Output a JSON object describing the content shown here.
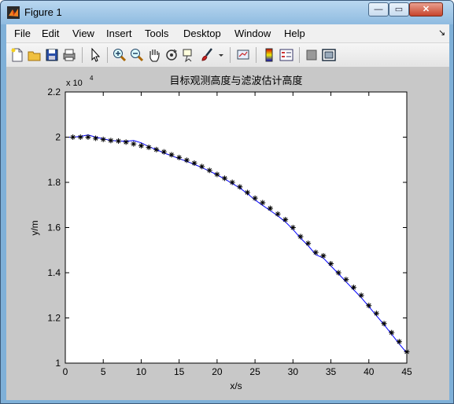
{
  "window": {
    "title": "Figure 1",
    "minimize": "—",
    "maximize": "▭",
    "close": "✕"
  },
  "menu": [
    "File",
    "Edit",
    "View",
    "Insert",
    "Tools",
    "Desktop",
    "Window",
    "Help"
  ],
  "dock_arrow": "↘",
  "toolbar": [
    "new-figure-icon",
    "open-file-icon",
    "save-icon",
    "print-icon",
    "arrow-pointer-icon",
    "zoom-in-icon",
    "zoom-out-icon",
    "pan-hand-icon",
    "rotate-3d-icon",
    "data-cursor-icon",
    "brush-icon",
    "brush-dropdown-icon",
    "link-plot-icon",
    "colorbar-icon",
    "legend-icon",
    "hide-plot-tools-icon",
    "show-plot-tools-icon"
  ],
  "chart_data": {
    "type": "line",
    "title": "目标观测高度与滤波估计高度",
    "xlabel": "x/s",
    "ylabel": "y/m",
    "y_exponent_label": "x 10",
    "y_exponent_power": "4",
    "xlim": [
      0,
      45
    ],
    "ylim": [
      1,
      2.2
    ],
    "x_ticks": [
      0,
      5,
      10,
      15,
      20,
      25,
      30,
      35,
      40,
      45
    ],
    "y_ticks": [
      1,
      1.2,
      1.4,
      1.6,
      1.8,
      2,
      2.2
    ],
    "y_tick_labels": [
      "1",
      "1.2",
      "1.4",
      "1.6",
      "1.8",
      "2",
      "2.2"
    ],
    "grid": false,
    "series": [
      {
        "style": "black asterisk markers",
        "color": "#000000",
        "x": [
          1,
          2,
          3,
          4,
          5,
          6,
          7,
          8,
          9,
          10,
          11,
          12,
          13,
          14,
          15,
          16,
          17,
          18,
          19,
          20,
          21,
          22,
          23,
          24,
          25,
          26,
          27,
          28,
          29,
          30,
          31,
          32,
          33,
          34,
          35,
          36,
          37,
          38,
          39,
          40,
          41,
          42,
          43,
          44,
          45
        ],
        "y": [
          2.0,
          2.0,
          2.0,
          1.995,
          1.99,
          1.985,
          1.983,
          1.978,
          1.97,
          1.962,
          1.955,
          1.945,
          1.935,
          1.922,
          1.91,
          1.898,
          1.885,
          1.87,
          1.853,
          1.835,
          1.818,
          1.8,
          1.78,
          1.755,
          1.73,
          1.71,
          1.685,
          1.66,
          1.635,
          1.6,
          1.56,
          1.53,
          1.49,
          1.475,
          1.44,
          1.4,
          1.37,
          1.335,
          1.3,
          1.255,
          1.22,
          1.175,
          1.135,
          1.095,
          1.05
        ]
      },
      {
        "style": "blue line",
        "color": "#0000ff",
        "x": [
          0,
          1,
          2,
          3,
          4,
          5,
          6,
          7,
          8,
          9,
          10,
          11,
          12,
          13,
          14,
          15,
          16,
          17,
          18,
          19,
          20,
          21,
          22,
          23,
          24,
          25,
          26,
          27,
          28,
          29,
          30,
          31,
          32,
          33,
          34,
          35,
          36,
          37,
          38,
          39,
          40,
          41,
          42,
          43,
          44,
          45
        ],
        "y": [
          2.0,
          2.0,
          2.003,
          2.01,
          2.0,
          1.993,
          1.985,
          1.983,
          1.982,
          1.985,
          1.975,
          1.958,
          1.945,
          1.93,
          1.918,
          1.905,
          1.893,
          1.88,
          1.865,
          1.85,
          1.833,
          1.815,
          1.795,
          1.775,
          1.75,
          1.722,
          1.698,
          1.675,
          1.652,
          1.625,
          1.592,
          1.553,
          1.52,
          1.48,
          1.465,
          1.43,
          1.395,
          1.36,
          1.325,
          1.29,
          1.25,
          1.21,
          1.17,
          1.128,
          1.085,
          1.045
        ]
      }
    ]
  }
}
